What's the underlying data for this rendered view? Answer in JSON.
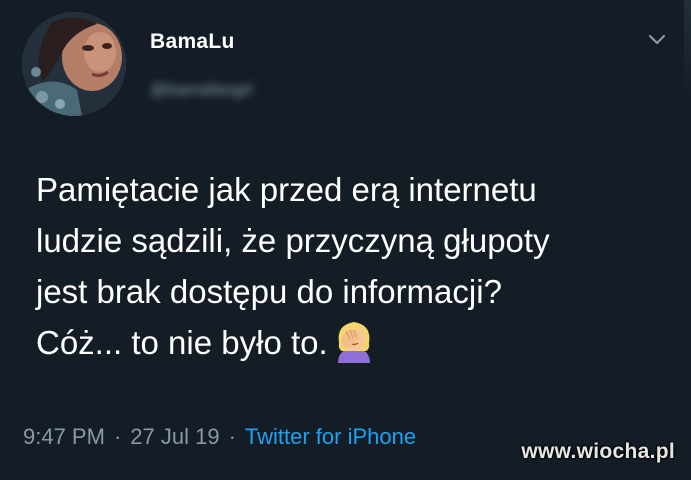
{
  "user": {
    "display_name": "BamaLu",
    "handle": "@bamafangrl"
  },
  "tweet": {
    "lines": [
      "Pamiętacie jak przed erą internetu",
      "ludzie sądzili, że przyczyną głupoty",
      "jest brak dostępu do informacji?",
      "Cóż... to nie było to."
    ],
    "emoji": "woman-facepalming-icon"
  },
  "meta": {
    "time": "9:47 PM",
    "separator": "·",
    "date": "27 Jul 19",
    "source": "Twitter for iPhone"
  },
  "watermark": "www.wiocha.pl",
  "colors": {
    "background": "#141d26",
    "text": "#ffffff",
    "secondary": "#8899a6",
    "link": "#1da1f2"
  }
}
